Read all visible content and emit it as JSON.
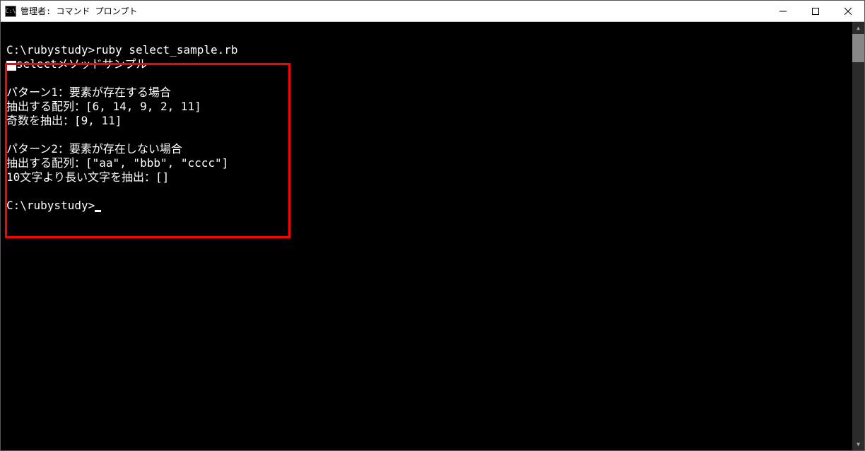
{
  "window": {
    "title": "管理者: コマンド プロンプト",
    "icon_label": "C:\\"
  },
  "terminal": {
    "lines": {
      "l1": "C:\\rubystudy>ruby select_sample.rb",
      "l2_suffix": "selectメソッドサンプル",
      "l3": "",
      "l4": "パターン1：要素が存在する場合",
      "l5": "抽出する配列：[6, 14, 9, 2, 11]",
      "l6": "奇数を抽出：[9, 11]",
      "l7": "",
      "l8": "パターン2：要素が存在しない場合",
      "l9": "抽出する配列：[\"aa\", \"bbb\", \"cccc\"]",
      "l10": "10文字より長い文字を抽出：[]",
      "l11": "",
      "l12_prefix": "C:\\rubystudy>"
    }
  }
}
